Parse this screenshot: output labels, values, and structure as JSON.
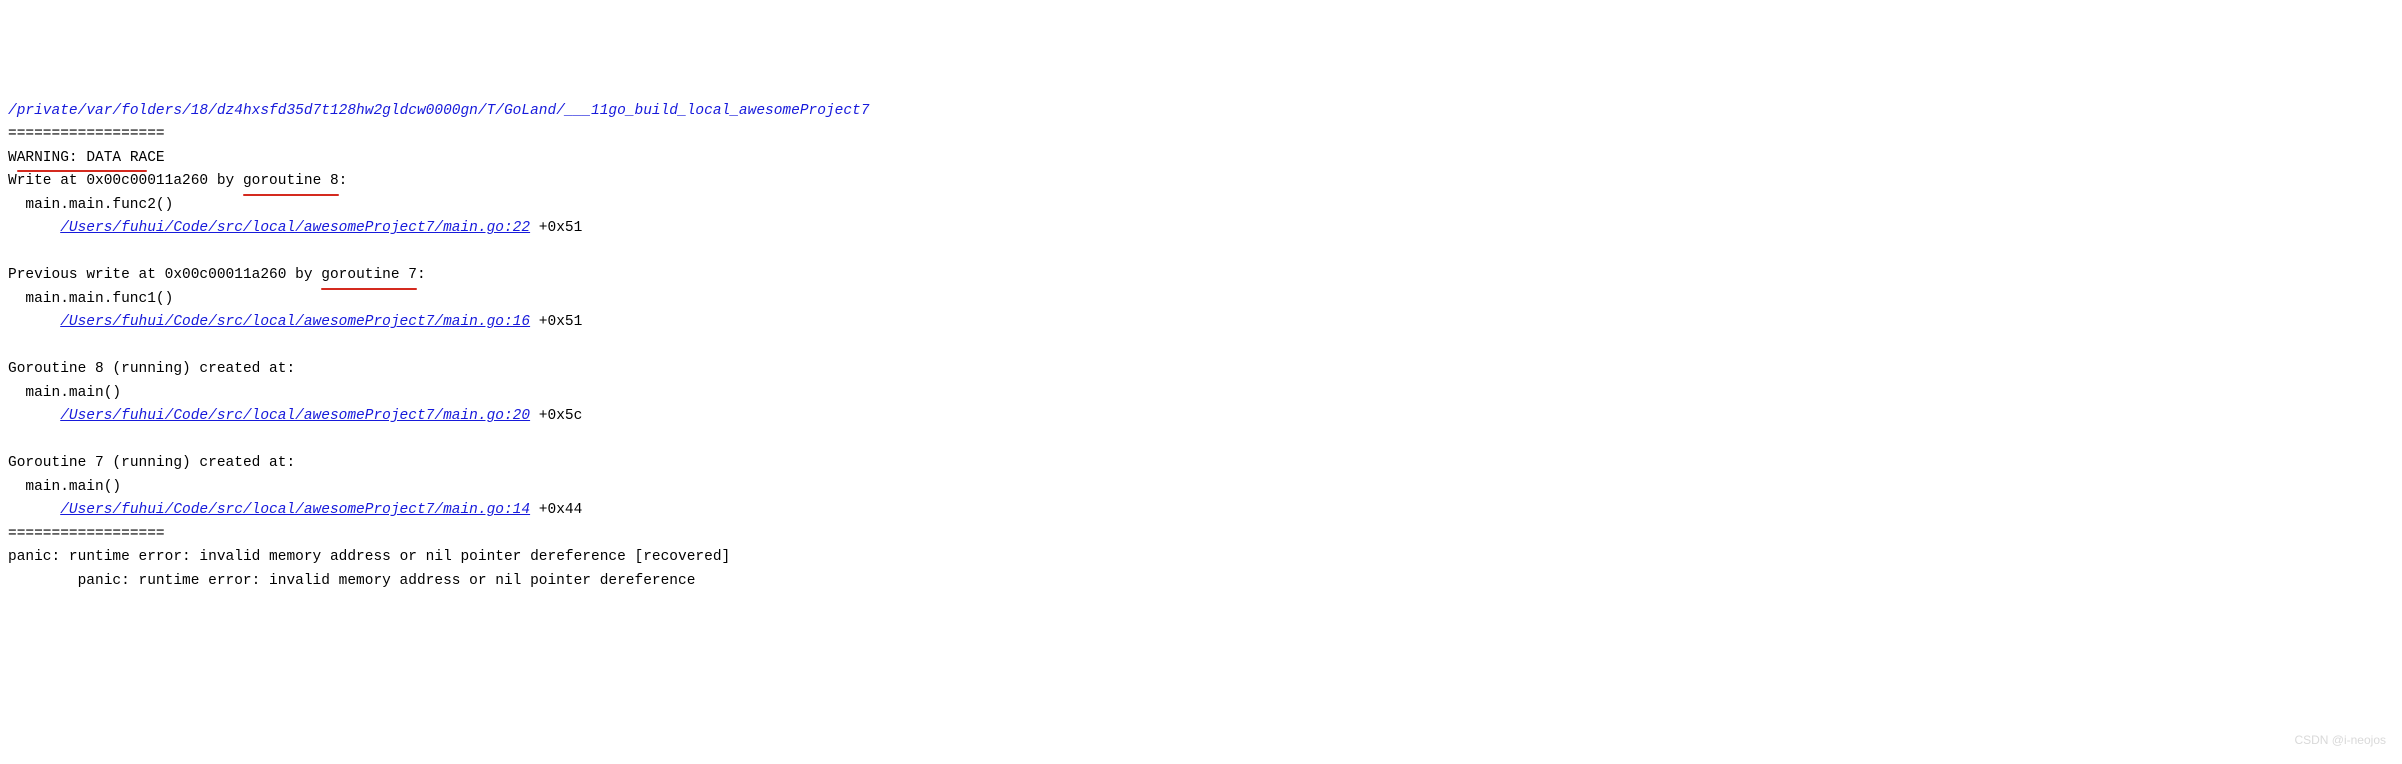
{
  "header_path": "/private/var/folders/18/dz4hxsfd35d7t128hw2gldcw0000gn/T/GoLand/___11go_build_local_awesomeProject7",
  "divider": "==================",
  "warning_line": {
    "prefix": "W",
    "underlined": "ARNING: DATA RA",
    "suffix": "CE"
  },
  "block1": {
    "write_prefix": "Write at 0x00c00011a260 by ",
    "goroutine_underlined": "goroutine 8",
    "colon": ":",
    "func": "main.main.func2()",
    "file": "/Users/fuhui/Code/src/local/awesomeProject7/main.go:22",
    "offset": " +0x51"
  },
  "block2": {
    "write_prefix": "Previous write at 0x00c00011a260 by ",
    "goroutine_underlined": "goroutine 7",
    "colon": ":",
    "func": "main.main.func1()",
    "file": "/Users/fuhui/Code/src/local/awesomeProject7/main.go:16",
    "offset": " +0x51"
  },
  "block3": {
    "header": "Goroutine 8 (running) created at:",
    "func": "main.main()",
    "file": "/Users/fuhui/Code/src/local/awesomeProject7/main.go:20",
    "offset": " +0x5c"
  },
  "block4": {
    "header": "Goroutine 7 (running) created at:",
    "func": "main.main()",
    "file": "/Users/fuhui/Code/src/local/awesomeProject7/main.go:14",
    "offset": " +0x44"
  },
  "panic1": "panic: runtime error: invalid memory address or nil pointer dereference [recovered]",
  "panic2": "panic: runtime error: invalid memory address or nil pointer dereference",
  "watermark": "CSDN @i-neojos"
}
